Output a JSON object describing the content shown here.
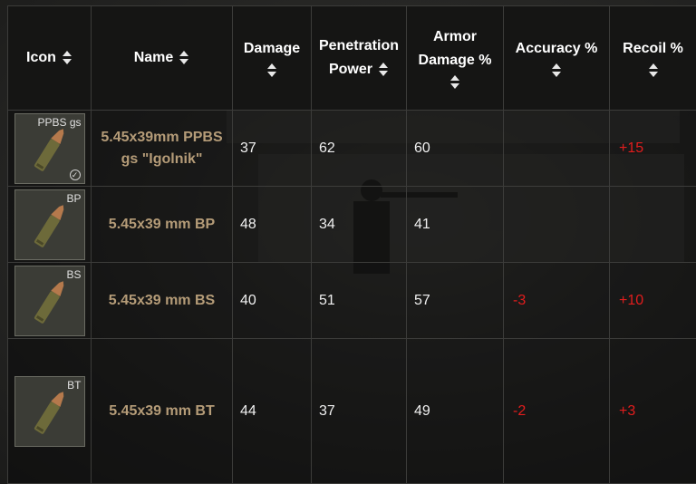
{
  "headers": {
    "icon": "Icon",
    "name": "Name",
    "damage": "Damage",
    "penetration_line1": "Penetration",
    "penetration_line2": "Power",
    "armor_line1": "Armor",
    "armor_line2": "Damage %",
    "accuracy": "Accuracy %",
    "recoil": "Recoil %"
  },
  "rows": [
    {
      "icon_label": "PPBS gs",
      "icon_check": true,
      "name": "5.45x39mm PPBS gs \"Igolnik\"",
      "damage": "37",
      "penetration": "62",
      "armor": "60",
      "accuracy": "",
      "recoil": "+15"
    },
    {
      "icon_label": "BP",
      "icon_check": false,
      "name": "5.45x39 mm BP",
      "damage": "48",
      "penetration": "34",
      "armor": "41",
      "accuracy": "",
      "recoil": ""
    },
    {
      "icon_label": "BS",
      "icon_check": false,
      "name": "5.45x39 mm BS",
      "damage": "40",
      "penetration": "51",
      "armor": "57",
      "accuracy": "-3",
      "recoil": "+10"
    },
    {
      "icon_label": "BT",
      "icon_check": false,
      "name": "5.45x39 mm BT",
      "damage": "44",
      "penetration": "37",
      "armor": "49",
      "accuracy": "-2",
      "recoil": "+3"
    }
  ],
  "icons": {
    "sort": "sort-arrows-icon",
    "cartridge": "cartridge-icon",
    "check": "check-circle-icon"
  },
  "colors": {
    "name_text": "#b59c78",
    "negative_stat": "#e21d1d",
    "header_bg": "#151514"
  }
}
